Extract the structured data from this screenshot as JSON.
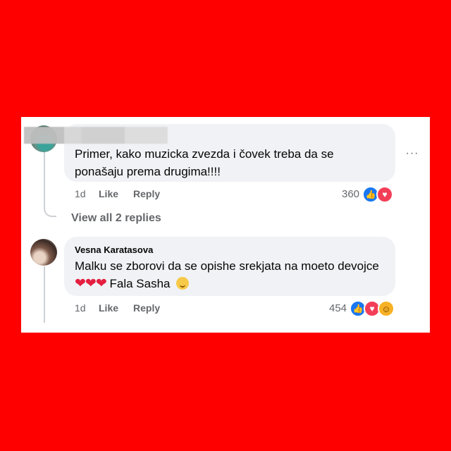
{
  "comments": [
    {
      "author": "",
      "text_line1": "Primer, kako muzicka zvezda i čovek treba da se",
      "text_line2": "ponašaju prema drugima!!!!",
      "time": "1d",
      "like_label": "Like",
      "reply_label": "Reply",
      "reaction_count": "360",
      "reactions": [
        "like-icon",
        "love-icon"
      ]
    },
    {
      "author": "Vesna Karatasova",
      "text_line1": "Malku se zborovi da se opishe srekjata na moeto devojce",
      "hearts": "❤❤❤",
      "text_line2": "Fala Sasha",
      "time": "1d",
      "like_label": "Like",
      "reply_label": "Reply",
      "reaction_count": "454",
      "reactions": [
        "like-icon",
        "love-icon",
        "care-icon"
      ]
    }
  ],
  "view_replies_label": "View all 2 replies",
  "more_options": "···",
  "colors": {
    "background": "#fe0000",
    "bubble": "#f0f2f5",
    "muted_text": "#65676b",
    "like_blue": "#1877f2",
    "love_red": "#f33e58",
    "care_yellow": "#f7b125"
  }
}
